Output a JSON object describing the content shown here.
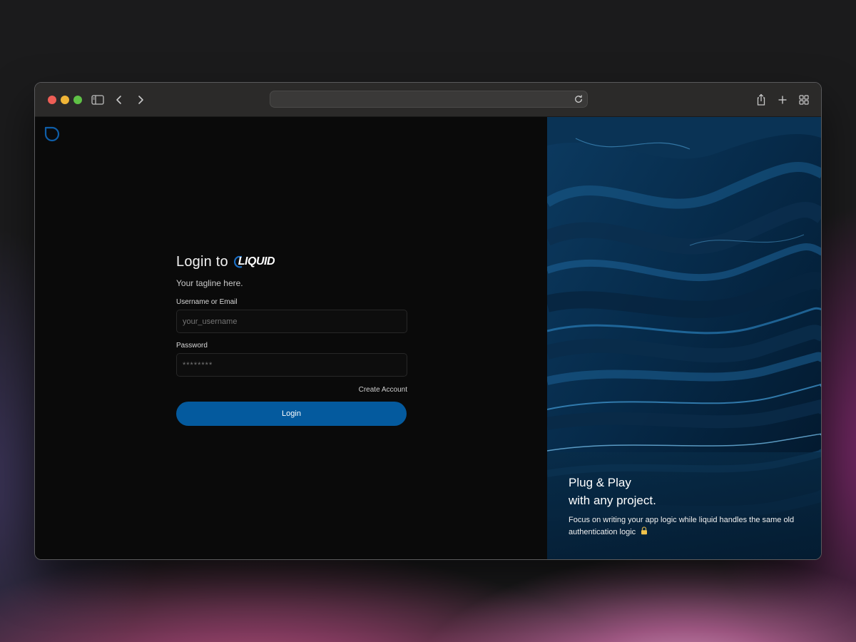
{
  "form": {
    "heading": "Login to",
    "brand_name": "LIQUID",
    "tagline": "Your tagline here.",
    "username_label": "Username or Email",
    "username_placeholder": "your_username",
    "password_label": "Password",
    "password_placeholder": "********",
    "create_account": "Create Account",
    "login_button": "Login"
  },
  "promo": {
    "title_line1": "Plug & Play",
    "title_line2": "with any project.",
    "body": "Focus on writing your app logic while liquid handles the same old authentication logic"
  },
  "icons": {
    "sidebar": "sidebar-icon",
    "back": "chevron-left-icon",
    "forward": "chevron-right-icon",
    "reload": "reload-icon",
    "share": "share-icon",
    "new_tab": "plus-icon",
    "tab_overview": "grid-icon",
    "lock": "lock-icon"
  },
  "colors": {
    "accent": "#045a9e",
    "background": "#0a0a0a",
    "logo_blue": "#0f5ea8"
  }
}
